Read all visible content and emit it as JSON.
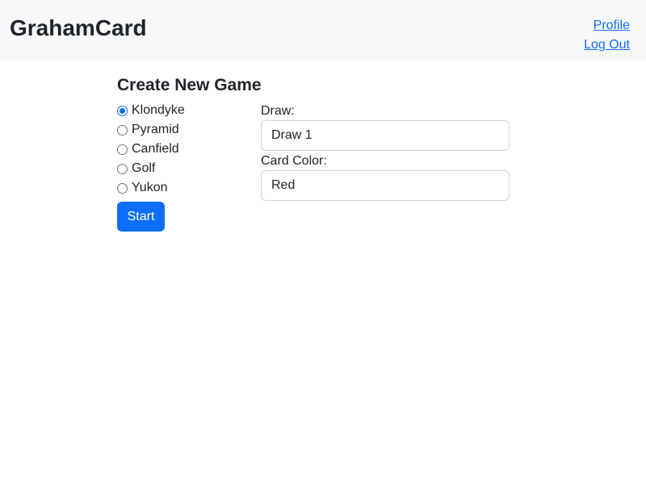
{
  "header": {
    "brand": "GrahamCard",
    "links": {
      "profile": "Profile",
      "logout": "Log Out"
    }
  },
  "main": {
    "title": "Create New Game",
    "games": [
      {
        "label": "Klondyke",
        "selected": true
      },
      {
        "label": "Pyramid",
        "selected": false
      },
      {
        "label": "Canfield",
        "selected": false
      },
      {
        "label": "Golf",
        "selected": false
      },
      {
        "label": "Yukon",
        "selected": false
      }
    ],
    "start_label": "Start",
    "draw": {
      "label": "Draw:",
      "value": "Draw 1"
    },
    "card_color": {
      "label": "Card Color:",
      "value": "Red"
    }
  },
  "colors": {
    "navbar_bg": "#f8f9fa",
    "primary": "#0d6efd",
    "text": "#212529",
    "input_border": "#ced4da"
  }
}
